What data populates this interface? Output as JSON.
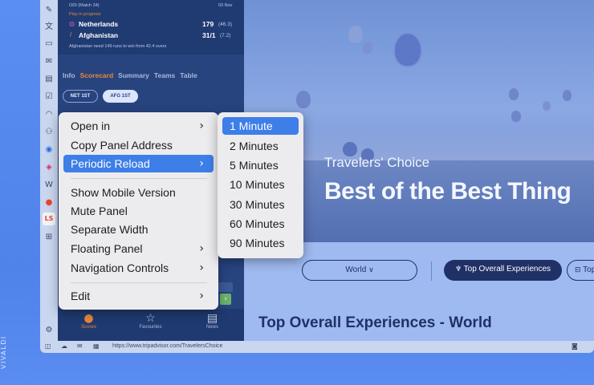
{
  "brand": {
    "vertical_label": "VIVALDI"
  },
  "panel": {
    "match_type": "ODI (Match 34)",
    "match_date": "03 Nov",
    "status": "Play in progress",
    "team1": {
      "name": "Netherlands",
      "score": "179",
      "overs": "(46.3)"
    },
    "team2": {
      "name": "Afghanistan",
      "score": "31/1",
      "overs": "(7.2)"
    },
    "note": "Afghanistan need 149 runs to win from 42.4 overs",
    "tabs": [
      "Info",
      "Scorecard",
      "Summary",
      "Teams",
      "Table"
    ],
    "active_tab": "Scorecard",
    "innings": [
      "NET 1ST",
      "AFG 1ST"
    ],
    "bottom_nav": [
      {
        "label": "Scores",
        "icon": "cricket-ball-icon"
      },
      {
        "label": "Favourites",
        "icon": "star-icon"
      },
      {
        "label": "News",
        "icon": "news-icon"
      }
    ]
  },
  "content": {
    "hero_small": "Travelers' Choice",
    "hero_big": "Best of the Best Thing",
    "chips": [
      "World",
      "Top Overall Experiences",
      "Top Attractio"
    ],
    "section_title": "Top Overall Experiences - World"
  },
  "statusbar": {
    "url": "https://www.tripadvisor.com/TravelersChoice"
  },
  "context_menu": {
    "items": [
      {
        "label": "Open in",
        "submenu": true
      },
      {
        "label": "Copy Panel Address",
        "submenu": false
      },
      {
        "label": "Periodic Reload",
        "submenu": true,
        "highlighted": true
      },
      {
        "label": "Show Mobile Version",
        "submenu": false
      },
      {
        "label": "Mute Panel",
        "submenu": false
      },
      {
        "label": "Separate Width",
        "submenu": false
      },
      {
        "label": "Floating Panel",
        "submenu": true
      },
      {
        "label": "Navigation Controls",
        "submenu": true
      },
      {
        "label": "Edit",
        "submenu": true
      }
    ]
  },
  "submenu": {
    "items": [
      "1 Minute",
      "2 Minutes",
      "5 Minutes",
      "10 Minutes",
      "30 Minutes",
      "60 Minutes",
      "90 Minutes"
    ],
    "highlighted": "1 Minute"
  },
  "colors": {
    "accent": "#3d7ee8",
    "active_tab": "#e8873a",
    "panel_bg": "#28447f"
  }
}
